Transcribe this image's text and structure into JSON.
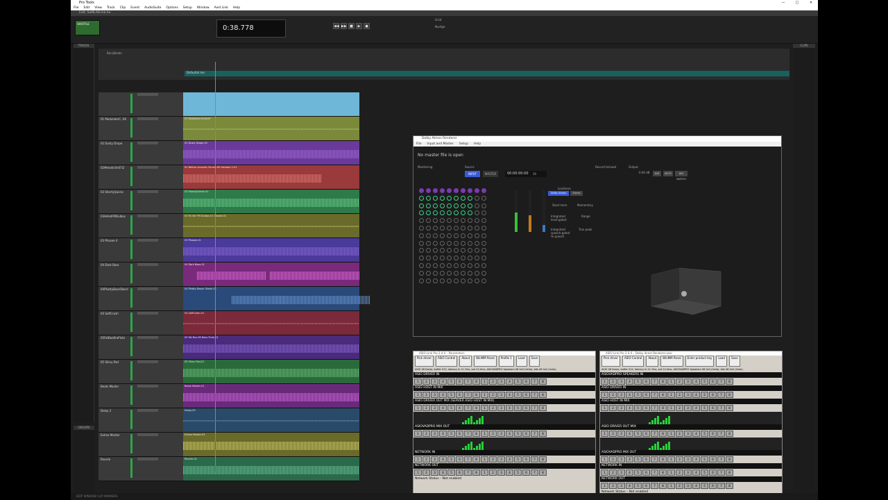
{
  "window": {
    "title": "Pro Tools",
    "controls": [
      "—",
      "□",
      "✕"
    ]
  },
  "menu": [
    "File",
    "Edit",
    "View",
    "Track",
    "Clip",
    "Event",
    "AudioSuite",
    "Options",
    "Setup",
    "Window",
    "Avid Link",
    "Help"
  ],
  "edit_window": {
    "title": "Edit: SoMLAB.mk.ho"
  },
  "toolbar": {
    "counter": "0:38.778",
    "mode_label": "SHUFFLE",
    "grid_label": "Grid",
    "nudge_label": "Nudge"
  },
  "transport": [
    "◀◀",
    "▶▶",
    "■",
    "▶",
    "●"
  ],
  "panels": {
    "tracks": "TRACKS",
    "groups": "GROUPS",
    "clips": "CLIPS"
  },
  "ruler": {
    "bar_label": "Bars|Beats",
    "clip_label": "Defaultal mo"
  },
  "tracks": [
    {
      "name": "",
      "clip": "",
      "color": "#6fb7d8",
      "wave": "#6fb7d8"
    },
    {
      "name": "01 ModulatorC..06",
      "clip": "01 Modulator.ScAtch*",
      "color": "#7a8a3a",
      "wave": "#a7c26a"
    },
    {
      "name": "02 Dusty Drope",
      "clip": "02 Dusty Drope-01",
      "color": "#6a3a9a",
      "wave": "#a06ad6"
    },
    {
      "name": "02Melodic0n07i2",
      "clip": "02 Nektar Acoustic Drums Kit Yamaha 2-01",
      "color": "#9a3a3a",
      "wave": "#e07a7a"
    },
    {
      "name": "03 ShortyQuicks",
      "clip": "03 ShortyQuicks-01",
      "color": "#2e7a4a",
      "wave": "#6ad08a"
    },
    {
      "name": "03HiHatFMDulbas",
      "clip": "03 Hi-Hat FM Dulbas 01 Closed-01",
      "color": "#6a6a2a",
      "wave": "#b8b86a"
    },
    {
      "name": "03 Phasee 4",
      "clip": "03 Phasee-01",
      "color": "#4a3a9a",
      "wave": "#8a6ad6"
    },
    {
      "name": "04 Dark Bass",
      "clip": "04 Dark Bass-01",
      "color": "#7a2a7a",
      "wave": "#e06ae0"
    },
    {
      "name": "04PhattyBassOberd",
      "clip": "04 Phatty Bassn Oberh-01",
      "color": "#2a4a7a",
      "wave": "#6a9ad6"
    },
    {
      "name": "04 SoftCrash",
      "clip": "04 SoftCrash-01",
      "color": "#7a2a3a",
      "wave": "#c06a7a"
    },
    {
      "name": "05FatBasBraPlute",
      "clip": "05 Fat Bus 60 Bass Flute-01",
      "color": "#4a2a7a",
      "wave": "#8a6ad6"
    },
    {
      "name": "05 Shiny Pad",
      "clip": "05 Shiny Pad-01",
      "color": "#2a6a3a",
      "wave": "#6ac07a"
    },
    {
      "name": "Beats Master",
      "clip": "Beats Master-01",
      "color": "#6a2a7a",
      "wave": "#d06ae0"
    },
    {
      "name": "Delay 2",
      "clip": "Delay-02",
      "color": "#2a4a6a",
      "wave": "#6a8ab0"
    },
    {
      "name": "Extras Master",
      "clip": "Extras Master-01",
      "color": "#6a6a2a",
      "wave": "#d0d06a"
    },
    {
      "name": "Reverb",
      "clip": "Reverb-01",
      "color": "#2a6a4a",
      "wave": "#6ac09a"
    }
  ],
  "dolby": {
    "title": "Dolby Atmos Renderer",
    "menu": [
      "File",
      "Input and Master",
      "Setup",
      "Help"
    ],
    "status": "No master file is open",
    "monitoring": "Monitoring",
    "source": "Source",
    "input": "INPUT",
    "master": "MASTER",
    "timecode": "00:00:00:00",
    "fps": "30",
    "record": "Record to/Load",
    "output": "Output",
    "output_val": "0.00 dB",
    "dim": "DIM",
    "mute": "MUTE",
    "binaural": "BIN SWITCH",
    "loudness": "Loudness",
    "dolby_atmos": "Dolby Atmos",
    "stereo": "Stereo",
    "short_term": "Short term",
    "momentary": "Momentary",
    "integrated": "Integrated level-gated",
    "range": "Range",
    "true_peak": "True peak",
    "integrated2": "Integrated speech-gated % speech"
  },
  "asio_left": {
    "title": "ASIO Link Pro 2.4.4 – Parameters",
    "buttons": [
      "Pick driver",
      "ASIO Control",
      "About",
      "WinMM Panel",
      "Profile 1",
      "Load",
      "Save"
    ],
    "info": "ASIO 48 Dusty, buffer 512, latency in 11.7ms, out 12.0ms, ASIOVADPRO Speakers 08 0x0 (0x0a), bits 08 0x0 (0x0a)",
    "sections": [
      "ASIO DRIVER IN",
      "ASIO HOST IN MIX",
      "ASIO DRIVER OUT MIX (SERVER ASIO HOST IN MIX)",
      "ASIOVADPRO MIX OUT",
      "NETWORK IN",
      "NETWORK OUT"
    ],
    "status": "Network Status – Not enabled"
  },
  "asio_right": {
    "title": "ASIO Link Pro 2.4.4 – Dolby direct Renderer.asio",
    "buttons": [
      "Pick driver",
      "ASIO Control",
      "About",
      "WinMM Panel",
      "Enter product key",
      "Load",
      "Save"
    ],
    "info": "ASIO 48 Dusty, buffer 512, latency in 11.7ms, out 12.0ms, ASIOVADPRO Speakers 08 0x0 (0x0a), bits 08 0x0 (0x0a)",
    "sections": [
      "ASIOVADPRO SPEAKERS IN",
      "ASIO DRIVER IN",
      "ASIO HOST IN MIX",
      "ASIO DRIVER OUT MIX",
      "ASIOVADPRO MIX OUT",
      "NETWORK IN",
      "NETWORK OUT"
    ],
    "status": "Network Status – Not enabled"
  },
  "bottom": "EDIT WINDOW     CLIP MARKERS"
}
